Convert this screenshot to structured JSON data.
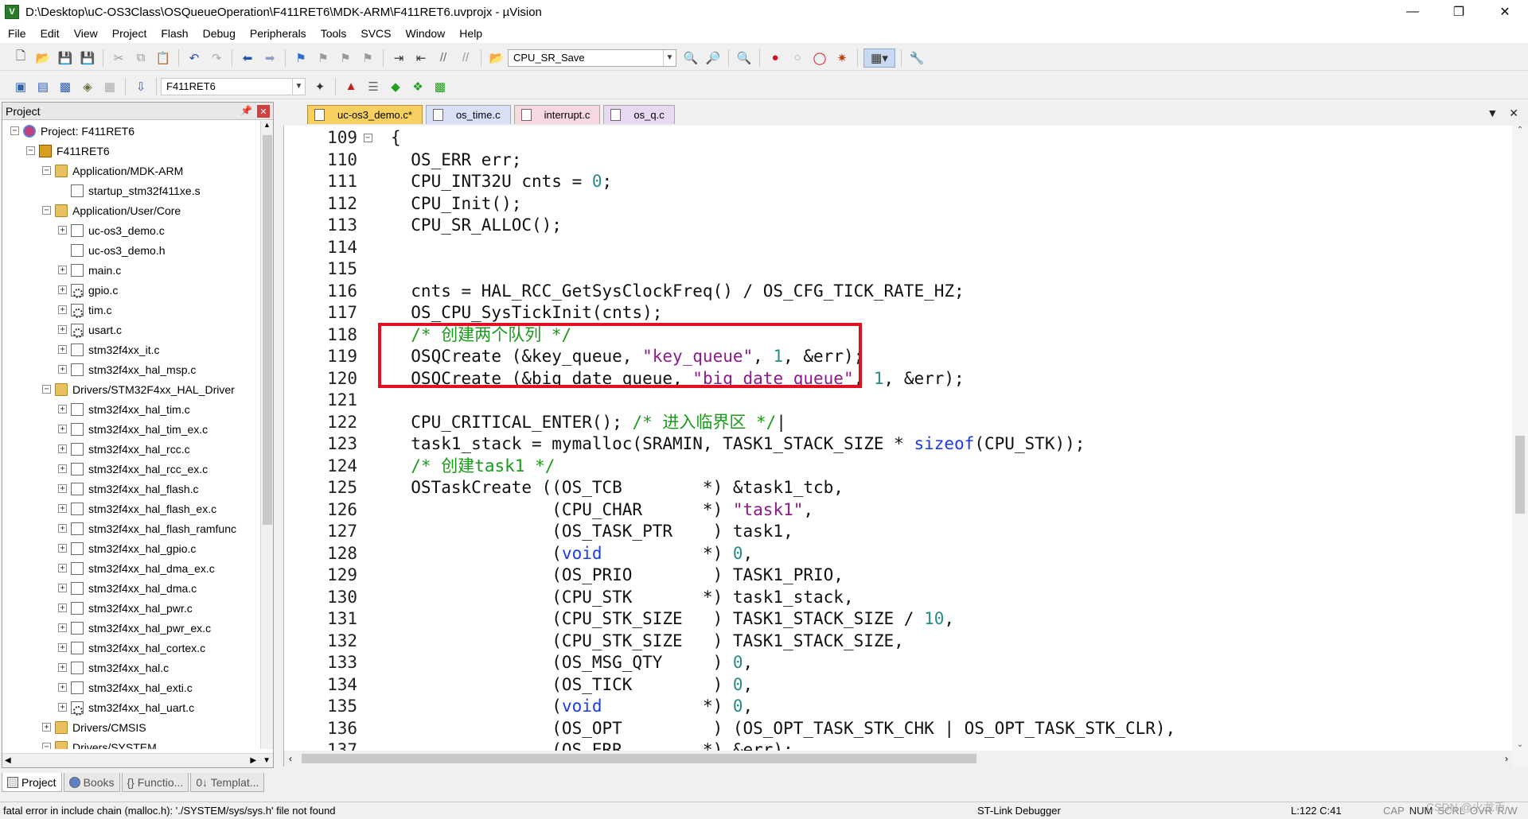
{
  "window": {
    "title": "D:\\Desktop\\uC-OS3Class\\OSQueueOperation\\F411RET6\\MDK-ARM\\F411RET6.uvprojx - µVision",
    "controls": [
      "minimize-icon",
      "restore-icon",
      "close-icon"
    ]
  },
  "menu": [
    "File",
    "Edit",
    "View",
    "Project",
    "Flash",
    "Debug",
    "Peripherals",
    "Tools",
    "SVCS",
    "Window",
    "Help"
  ],
  "toolbar": {
    "find_combo_value": "CPU_SR_Save"
  },
  "build_toolbar": {
    "target_combo_value": "F411RET6"
  },
  "project_panel": {
    "title": "Project",
    "tree": [
      {
        "label": "Project: F411RET6",
        "level": 0,
        "exp": "-",
        "icon": "project"
      },
      {
        "label": "F411RET6",
        "level": 1,
        "exp": "-",
        "icon": "target"
      },
      {
        "label": "Application/MDK-ARM",
        "level": 2,
        "exp": "-",
        "icon": "folder"
      },
      {
        "label": "startup_stm32f411xe.s",
        "level": 3,
        "exp": "",
        "icon": "file"
      },
      {
        "label": "Application/User/Core",
        "level": 2,
        "exp": "-",
        "icon": "folder"
      },
      {
        "label": "uc-os3_demo.c",
        "level": 3,
        "exp": "+",
        "icon": "file"
      },
      {
        "label": "uc-os3_demo.h",
        "level": 3,
        "exp": "",
        "icon": "file"
      },
      {
        "label": "main.c",
        "level": 3,
        "exp": "+",
        "icon": "file"
      },
      {
        "label": "gpio.c",
        "level": 3,
        "exp": "+",
        "icon": "gear"
      },
      {
        "label": "tim.c",
        "level": 3,
        "exp": "+",
        "icon": "gear"
      },
      {
        "label": "usart.c",
        "level": 3,
        "exp": "+",
        "icon": "gear"
      },
      {
        "label": "stm32f4xx_it.c",
        "level": 3,
        "exp": "+",
        "icon": "file"
      },
      {
        "label": "stm32f4xx_hal_msp.c",
        "level": 3,
        "exp": "+",
        "icon": "file"
      },
      {
        "label": "Drivers/STM32F4xx_HAL_Driver",
        "level": 2,
        "exp": "-",
        "icon": "folder"
      },
      {
        "label": "stm32f4xx_hal_tim.c",
        "level": 3,
        "exp": "+",
        "icon": "file"
      },
      {
        "label": "stm32f4xx_hal_tim_ex.c",
        "level": 3,
        "exp": "+",
        "icon": "file"
      },
      {
        "label": "stm32f4xx_hal_rcc.c",
        "level": 3,
        "exp": "+",
        "icon": "file"
      },
      {
        "label": "stm32f4xx_hal_rcc_ex.c",
        "level": 3,
        "exp": "+",
        "icon": "file"
      },
      {
        "label": "stm32f4xx_hal_flash.c",
        "level": 3,
        "exp": "+",
        "icon": "file"
      },
      {
        "label": "stm32f4xx_hal_flash_ex.c",
        "level": 3,
        "exp": "+",
        "icon": "file"
      },
      {
        "label": "stm32f4xx_hal_flash_ramfunc",
        "level": 3,
        "exp": "+",
        "icon": "file"
      },
      {
        "label": "stm32f4xx_hal_gpio.c",
        "level": 3,
        "exp": "+",
        "icon": "file"
      },
      {
        "label": "stm32f4xx_hal_dma_ex.c",
        "level": 3,
        "exp": "+",
        "icon": "file"
      },
      {
        "label": "stm32f4xx_hal_dma.c",
        "level": 3,
        "exp": "+",
        "icon": "file"
      },
      {
        "label": "stm32f4xx_hal_pwr.c",
        "level": 3,
        "exp": "+",
        "icon": "file"
      },
      {
        "label": "stm32f4xx_hal_pwr_ex.c",
        "level": 3,
        "exp": "+",
        "icon": "file"
      },
      {
        "label": "stm32f4xx_hal_cortex.c",
        "level": 3,
        "exp": "+",
        "icon": "file"
      },
      {
        "label": "stm32f4xx_hal.c",
        "level": 3,
        "exp": "+",
        "icon": "file"
      },
      {
        "label": "stm32f4xx_hal_exti.c",
        "level": 3,
        "exp": "+",
        "icon": "file"
      },
      {
        "label": "stm32f4xx_hal_uart.c",
        "level": 3,
        "exp": "+",
        "icon": "gear"
      },
      {
        "label": "Drivers/CMSIS",
        "level": 2,
        "exp": "+",
        "icon": "folder"
      },
      {
        "label": "Drivers/SYSTEM",
        "level": 2,
        "exp": "-",
        "icon": "folder"
      }
    ],
    "bottom_tabs": [
      "Project",
      "Books",
      "{} Functio...",
      "0↓ Templat..."
    ]
  },
  "editor": {
    "tabs": [
      {
        "label": "uc-os3_demo.c*",
        "style": "active"
      },
      {
        "label": "os_time.c",
        "style": "blue"
      },
      {
        "label": "interrupt.c",
        "style": "pink"
      },
      {
        "label": "os_q.c",
        "style": "lav"
      }
    ],
    "lines": [
      {
        "n": "109",
        "fold": "-",
        "parts": [
          [
            "",
            "{"
          ]
        ]
      },
      {
        "n": "110",
        "parts": [
          [
            "",
            "  OS_ERR err;"
          ]
        ]
      },
      {
        "n": "111",
        "parts": [
          [
            "",
            "  CPU_INT32U cnts = "
          ],
          [
            "num",
            "0"
          ],
          [
            "",
            ";"
          ]
        ]
      },
      {
        "n": "112",
        "parts": [
          [
            "",
            "  CPU_Init();"
          ]
        ]
      },
      {
        "n": "113",
        "parts": [
          [
            "",
            "  CPU_SR_ALLOC();"
          ]
        ]
      },
      {
        "n": "114",
        "parts": [
          [
            "",
            ""
          ]
        ]
      },
      {
        "n": "115",
        "parts": [
          [
            "",
            ""
          ]
        ]
      },
      {
        "n": "116",
        "parts": [
          [
            "",
            "  cnts = HAL_RCC_GetSysClockFreq() / OS_CFG_TICK_RATE_HZ;"
          ]
        ]
      },
      {
        "n": "117",
        "parts": [
          [
            "",
            "  OS_CPU_SysTickInit(cnts);"
          ]
        ]
      },
      {
        "n": "118",
        "parts": [
          [
            "cm",
            "  /* 创建两个队列 */"
          ]
        ]
      },
      {
        "n": "119",
        "parts": [
          [
            "",
            "  OSQCreate (&key_queue, "
          ],
          [
            "str",
            "\"key_queue\""
          ],
          [
            "",
            ", "
          ],
          [
            "num",
            "1"
          ],
          [
            "",
            ", &err);"
          ]
        ]
      },
      {
        "n": "120",
        "parts": [
          [
            "",
            "  OSQCreate (&big_date_queue, "
          ],
          [
            "str",
            "\"big_date_queue\""
          ],
          [
            "",
            ", "
          ],
          [
            "num",
            "1"
          ],
          [
            "",
            ", &err);"
          ]
        ]
      },
      {
        "n": "121",
        "parts": [
          [
            "",
            ""
          ]
        ]
      },
      {
        "n": "122",
        "parts": [
          [
            "",
            "  CPU_CRITICAL_ENTER(); "
          ],
          [
            "cm",
            "/* 进入临界区 */"
          ],
          [
            "",
            "|"
          ]
        ]
      },
      {
        "n": "123",
        "parts": [
          [
            "",
            "  task1_stack = mymalloc(SRAMIN, TASK1_STACK_SIZE * "
          ],
          [
            "kw",
            "sizeof"
          ],
          [
            "",
            "(CPU_STK));"
          ]
        ]
      },
      {
        "n": "124",
        "parts": [
          [
            "cm",
            "  /* 创建task1 */"
          ]
        ]
      },
      {
        "n": "125",
        "parts": [
          [
            "",
            "  OSTaskCreate ((OS_TCB        *) &task1_tcb,"
          ]
        ]
      },
      {
        "n": "126",
        "parts": [
          [
            "",
            "                (CPU_CHAR      *) "
          ],
          [
            "str",
            "\"task1\""
          ],
          [
            "",
            ","
          ]
        ]
      },
      {
        "n": "127",
        "parts": [
          [
            "",
            "                (OS_TASK_PTR    ) task1,"
          ]
        ]
      },
      {
        "n": "128",
        "parts": [
          [
            "",
            "                ("
          ],
          [
            "kw",
            "void"
          ],
          [
            "",
            "          *) "
          ],
          [
            "num",
            "0"
          ],
          [
            "",
            ","
          ]
        ]
      },
      {
        "n": "129",
        "parts": [
          [
            "",
            "                (OS_PRIO        ) TASK1_PRIO,"
          ]
        ]
      },
      {
        "n": "130",
        "parts": [
          [
            "",
            "                (CPU_STK       *) task1_stack,"
          ]
        ]
      },
      {
        "n": "131",
        "parts": [
          [
            "",
            "                (CPU_STK_SIZE   ) TASK1_STACK_SIZE / "
          ],
          [
            "num",
            "10"
          ],
          [
            "",
            ","
          ]
        ]
      },
      {
        "n": "132",
        "parts": [
          [
            "",
            "                (CPU_STK_SIZE   ) TASK1_STACK_SIZE,"
          ]
        ]
      },
      {
        "n": "133",
        "parts": [
          [
            "",
            "                (OS_MSG_QTY     ) "
          ],
          [
            "num",
            "0"
          ],
          [
            "",
            ","
          ]
        ]
      },
      {
        "n": "134",
        "parts": [
          [
            "",
            "                (OS_TICK        ) "
          ],
          [
            "num",
            "0"
          ],
          [
            "",
            ","
          ]
        ]
      },
      {
        "n": "135",
        "parts": [
          [
            "",
            "                ("
          ],
          [
            "kw",
            "void"
          ],
          [
            "",
            "          *) "
          ],
          [
            "num",
            "0"
          ],
          [
            "",
            ","
          ]
        ]
      },
      {
        "n": "136",
        "parts": [
          [
            "",
            "                (OS_OPT         ) (OS_OPT_TASK_STK_CHK | OS_OPT_TASK_STK_CLR),"
          ]
        ]
      },
      {
        "n": "137",
        "parts": [
          [
            "",
            "                (OS_ERR        *) &err);"
          ]
        ]
      },
      {
        "n": "138",
        "parts": [
          [
            "",
            ""
          ]
        ]
      }
    ]
  },
  "statusbar": {
    "message": "fatal error in include chain (malloc.h): './SYSTEM/sys/sys.h' file not found",
    "debugger": "ST-Link Debugger",
    "position": "L:122 C:41",
    "keys": [
      "CAP",
      "NUM",
      "SCRL",
      "OVR",
      "R/W"
    ]
  },
  "watermark": "CSDN @火龙币",
  "colors": {
    "comment": "#1a9a1a",
    "string": "#8b1a8b",
    "number": "#2a8a8a",
    "keyword": "#1a3aee",
    "highlight_box": "#e01020",
    "active_tab": "#f8d060"
  }
}
